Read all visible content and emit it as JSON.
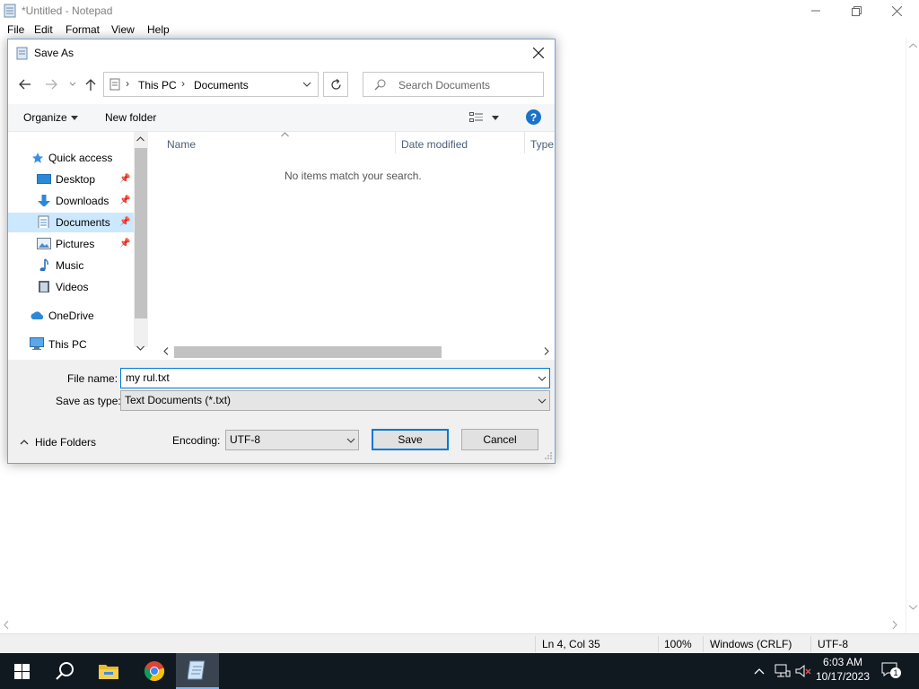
{
  "notepad": {
    "title": "*Untitled - Notepad",
    "menu": [
      "File",
      "Edit",
      "Format",
      "View",
      "Help"
    ],
    "status": {
      "position": "Ln 4, Col 35",
      "zoom": "100%",
      "line_ending": "Windows (CRLF)",
      "encoding": "UTF-8"
    }
  },
  "dialog": {
    "title": "Save As",
    "breadcrumb": [
      "This PC",
      "Documents"
    ],
    "search_placeholder": "Search Documents",
    "toolbar": {
      "organize": "Organize",
      "new_folder": "New folder",
      "help": "?"
    },
    "nav": {
      "quick_access": "Quick access",
      "items": [
        "Desktop",
        "Downloads",
        "Documents",
        "Pictures",
        "Music",
        "Videos"
      ],
      "onedrive": "OneDrive",
      "this_pc": "This PC"
    },
    "columns": {
      "name": "Name",
      "date": "Date modified",
      "type": "Type"
    },
    "empty_message": "No items match your search.",
    "file_name_label": "File name:",
    "file_name_value": "my rul.txt",
    "save_type_label": "Save as type:",
    "save_type_value": "Text Documents (*.txt)",
    "hide_folders": "Hide Folders",
    "encoding_label": "Encoding:",
    "encoding_value": "UTF-8",
    "save_button": "Save",
    "cancel_button": "Cancel"
  },
  "taskbar": {
    "time": "6:03 AM",
    "date": "10/17/2023",
    "notification_count": "1",
    "apps": [
      "start-icon",
      "search-icon",
      "file-explorer-icon",
      "chrome-icon",
      "notepad-icon"
    ]
  },
  "colors": {
    "accent": "#0078d7",
    "taskbar": "#101820",
    "selection": "#cce8ff",
    "help": "#1a73c8"
  }
}
